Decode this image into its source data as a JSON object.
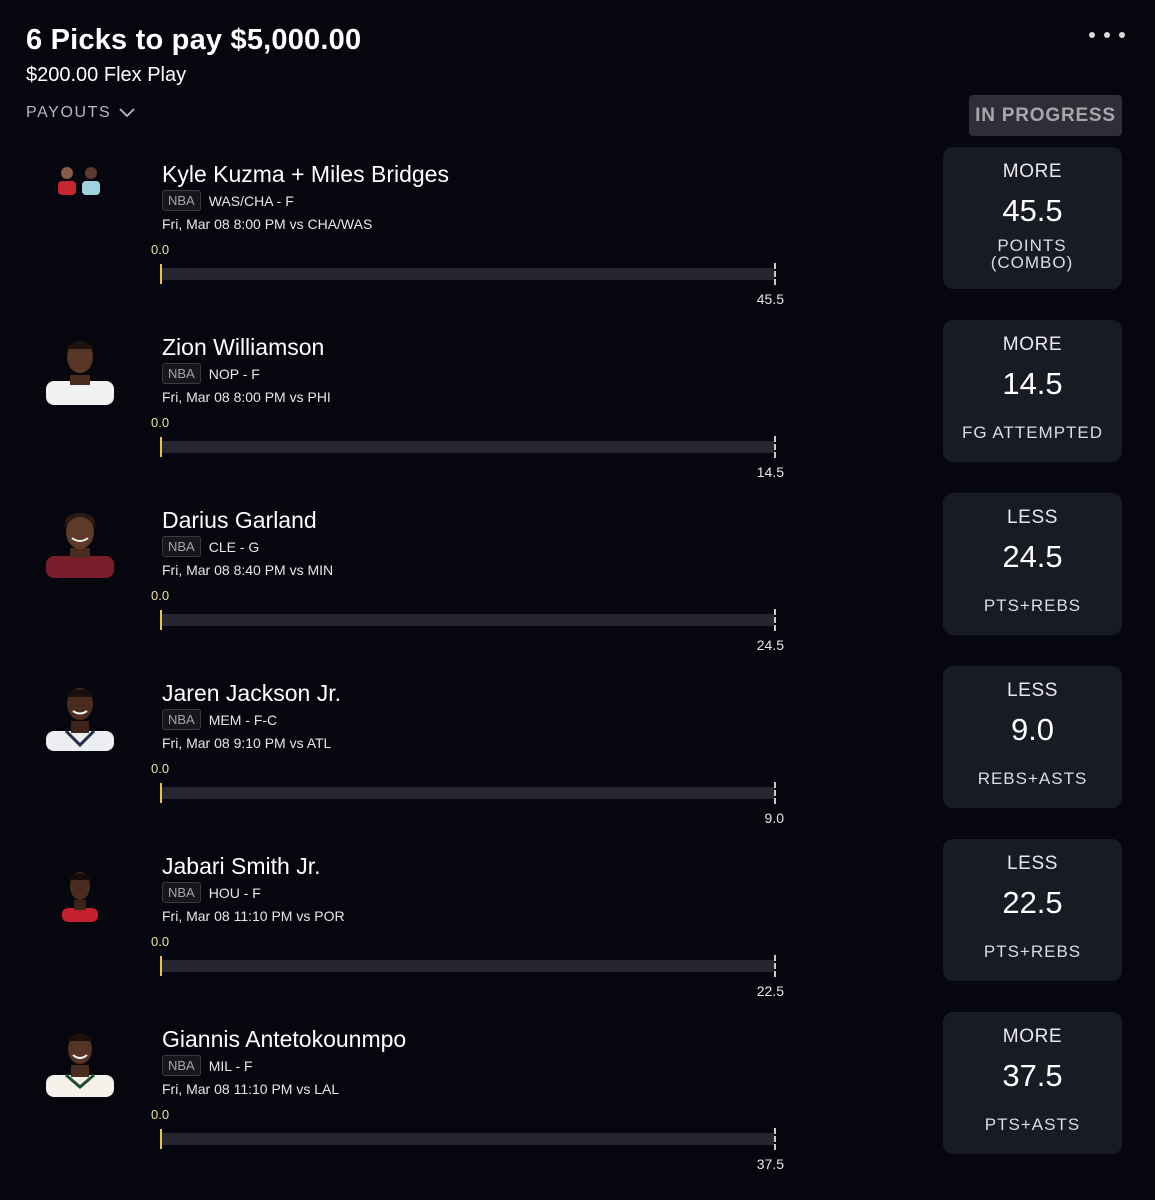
{
  "header": {
    "title": "6 Picks to pay $5,000.00",
    "subtitle": "$200.00 Flex Play",
    "payouts_label": "PAYOUTS",
    "status": "IN PROGRESS"
  },
  "colors": {
    "background": "#06060e",
    "card": "#181a24",
    "progress_track": "#26262f",
    "current_marker": "#e7c640",
    "status_badge": "#2e2f36"
  },
  "picks": [
    {
      "name": "Kyle Kuzma + Miles Bridges",
      "league": "NBA",
      "team_pos": "WAS/CHA - F",
      "game_time": "Fri, Mar 08 8:00 PM  vs CHA/WAS",
      "current": "0.0",
      "target": "45.5",
      "direction": "MORE",
      "line": "45.5",
      "stat": "POINTS (COMBO)",
      "progress": 0
    },
    {
      "name": "Zion Williamson",
      "league": "NBA",
      "team_pos": "NOP - F",
      "game_time": "Fri, Mar 08 8:00 PM  vs PHI",
      "current": "0.0",
      "target": "14.5",
      "direction": "MORE",
      "line": "14.5",
      "stat": "FG ATTEMPTED",
      "progress": 0
    },
    {
      "name": "Darius Garland",
      "league": "NBA",
      "team_pos": "CLE - G",
      "game_time": "Fri, Mar 08 8:40 PM  vs MIN",
      "current": "0.0",
      "target": "24.5",
      "direction": "LESS",
      "line": "24.5",
      "stat": "PTS+REBS",
      "progress": 0
    },
    {
      "name": "Jaren Jackson Jr.",
      "league": "NBA",
      "team_pos": "MEM - F-C",
      "game_time": "Fri, Mar 08 9:10 PM  vs ATL",
      "current": "0.0",
      "target": "9.0",
      "direction": "LESS",
      "line": "9.0",
      "stat": "REBS+ASTS",
      "progress": 0
    },
    {
      "name": "Jabari Smith Jr.",
      "league": "NBA",
      "team_pos": "HOU - F",
      "game_time": "Fri, Mar 08 11:10 PM  vs POR",
      "current": "0.0",
      "target": "22.5",
      "direction": "LESS",
      "line": "22.5",
      "stat": "PTS+REBS",
      "progress": 0
    },
    {
      "name": "Giannis Antetokounmpo",
      "league": "NBA",
      "team_pos": "MIL - F",
      "game_time": "Fri, Mar 08 11:10 PM  vs LAL",
      "current": "0.0",
      "target": "37.5",
      "direction": "MORE",
      "line": "37.5",
      "stat": "PTS+ASTS",
      "progress": 0
    }
  ]
}
